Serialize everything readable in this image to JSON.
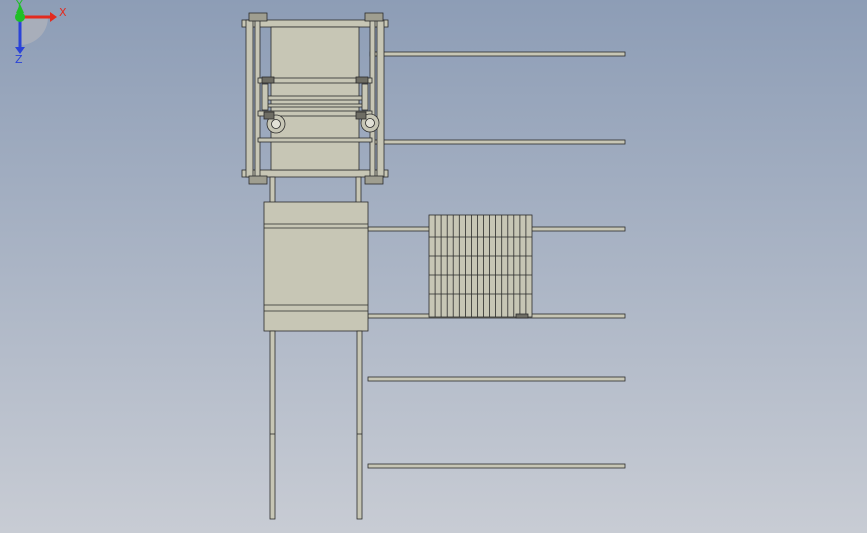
{
  "viewport": {
    "background_top": "#8d9db6",
    "background_bottom": "#c8ccd4",
    "part_fill": "#c7c6b5",
    "edge_color": "#2b2b2b",
    "detail_fill": "#e2e1d6"
  },
  "triad": {
    "x_label": "X",
    "y_label": "Y",
    "z_label": "Z",
    "x_color": "#e32b1f",
    "y_color": "#1fbf26",
    "z_color": "#2a43d8"
  }
}
